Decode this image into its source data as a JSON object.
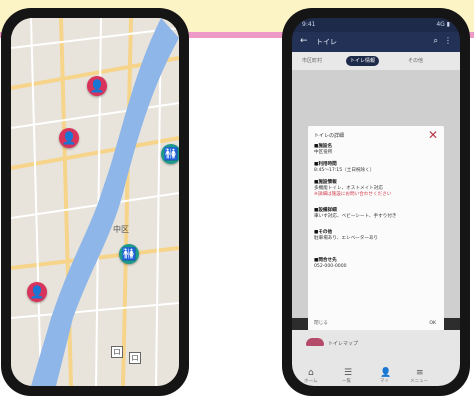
{
  "left_phone": {
    "map_labels": [
      "中区"
    ],
    "pins": [
      {
        "kind": "red",
        "icon": "person-icon",
        "glyph": "👤"
      },
      {
        "kind": "red",
        "icon": "person-icon",
        "glyph": "👤"
      },
      {
        "kind": "green",
        "icon": "restroom-icon",
        "glyph": "🚻"
      },
      {
        "kind": "green",
        "icon": "restroom-icon",
        "glyph": "🚻"
      },
      {
        "kind": "red",
        "icon": "person-icon",
        "glyph": "👤"
      }
    ],
    "box_icons": [
      "口",
      "口"
    ]
  },
  "right_phone": {
    "status": {
      "left": "9:41",
      "right": "4G ▮"
    },
    "header": {
      "back": "←",
      "title": "トイレ",
      "icons": [
        "⌕",
        "⋮"
      ]
    },
    "tabs": [
      {
        "label": "市区町村"
      },
      {
        "label": "トイレ情報",
        "active": true
      },
      {
        "label": "その他"
      }
    ],
    "modal": {
      "title": "トイレの詳細",
      "close": "✕",
      "sections": [
        {
          "heading": "■施設名",
          "body": "中区役所"
        },
        {
          "heading": "■利用時間",
          "body": "8:45〜17:15（土日祝除く）"
        },
        {
          "heading": "■施設情報",
          "body": "多機能トイレ、オストメイト対応",
          "note": "※詳細は施設にお問い合わせください"
        },
        {
          "heading": "■設備詳細",
          "body": "車いす対応、ベビーシート、手すり付き"
        },
        {
          "heading": "■その他",
          "body": "駐車場あり、エレベーターあり"
        },
        {
          "heading": "■問合せ先",
          "body": "052-000-0000"
        }
      ],
      "footer": "閉じる",
      "ok": "OK"
    },
    "bottom": {
      "logo_text": "トイレマップ",
      "nav": [
        {
          "icon": "home-icon",
          "glyph": "⌂",
          "label": "ホーム"
        },
        {
          "icon": "list-icon",
          "glyph": "☰",
          "label": "一覧"
        },
        {
          "icon": "user-icon",
          "glyph": "👤",
          "label": "マイ"
        },
        {
          "icon": "menu-icon",
          "glyph": "≡",
          "label": "メニュー"
        }
      ]
    }
  },
  "colors": {
    "band": "#fdf4c6",
    "pink_line": "#ee9ac6",
    "pin_red": "#d8335b",
    "pin_green": "#1f9a8a"
  }
}
